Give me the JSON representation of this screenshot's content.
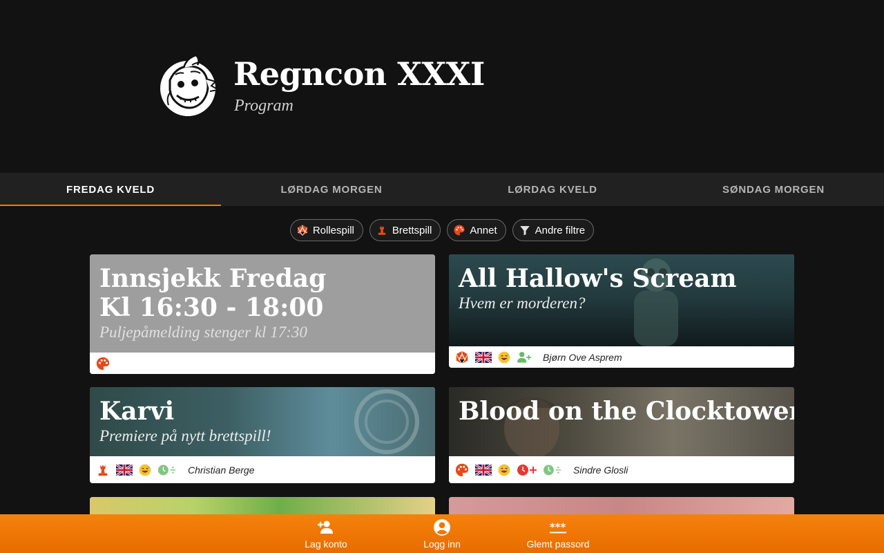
{
  "site": {
    "title": "Regncon XXXI",
    "subtitle": "Program"
  },
  "tabs": [
    {
      "label": "FREDAG KVELD",
      "active": true
    },
    {
      "label": "LØRDAG MORGEN",
      "active": false
    },
    {
      "label": "LØRDAG KVELD",
      "active": false
    },
    {
      "label": "SØNDAG MORGEN",
      "active": false
    }
  ],
  "filters": [
    {
      "label": "Rollespill",
      "icon": "d20-icon"
    },
    {
      "label": "Brettspill",
      "icon": "chess-piece-icon"
    },
    {
      "label": "Annet",
      "icon": "palette-icon"
    },
    {
      "label": "Andre filtre",
      "icon": "filter-icon"
    }
  ],
  "events": [
    {
      "title_line1": "Innsjekk Fredag",
      "title_line2": "Kl 16:30 - 18:00",
      "subtitle": "Puljepåmelding stenger kl 17:30",
      "game_master": "",
      "icons": [
        "palette-icon"
      ]
    },
    {
      "title": "All Hallow's Scream",
      "subtitle": "Hvem er morderen?",
      "game_master": "Bjørn Ove Asprem",
      "icons": [
        "d20-icon",
        "uk-flag-icon",
        "laughing-face-icon",
        "add-person-icon"
      ]
    },
    {
      "title": "Karvi",
      "subtitle": "Premiere på nytt brettspill!",
      "game_master": "Christian Berge",
      "icons": [
        "chess-piece-icon",
        "uk-flag-icon",
        "laughing-face-icon",
        "clock-split-icon"
      ]
    },
    {
      "title": "Blood on the Clocktower",
      "subtitle": "",
      "game_master": "Sindre Glosli",
      "icons": [
        "palette-icon",
        "uk-flag-icon",
        "laughing-face-icon",
        "clock-plus-icon",
        "clock-split-icon"
      ]
    },
    {
      "title": "",
      "subtitle": "",
      "game_master": "",
      "icons": []
    },
    {
      "title": "",
      "subtitle": "",
      "game_master": "",
      "icons": []
    }
  ],
  "footer": {
    "create_account": "Lag konto",
    "login": "Logg inn",
    "forgot_password": "Glemt passord"
  },
  "colors": {
    "accent": "#f57c00",
    "footer": "#f5820b",
    "background": "#121212",
    "tabbar": "#212121"
  }
}
